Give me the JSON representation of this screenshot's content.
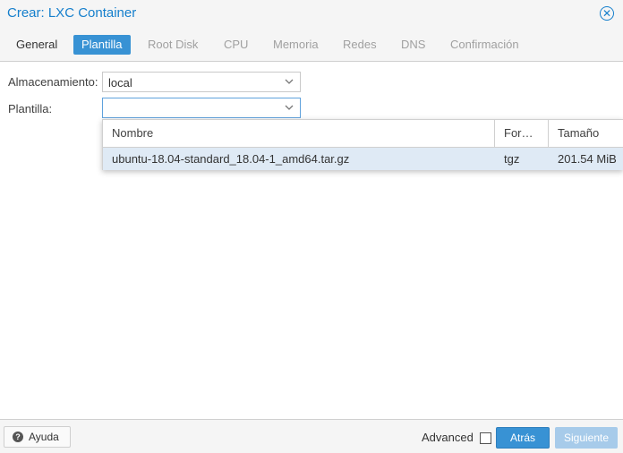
{
  "window": {
    "title": "Crear: LXC Container",
    "close_icon": "close-circle-icon"
  },
  "tabs": [
    {
      "label": "General",
      "state": "enabled"
    },
    {
      "label": "Plantilla",
      "state": "active"
    },
    {
      "label": "Root Disk",
      "state": "disabled"
    },
    {
      "label": "CPU",
      "state": "disabled"
    },
    {
      "label": "Memoria",
      "state": "disabled"
    },
    {
      "label": "Redes",
      "state": "disabled"
    },
    {
      "label": "DNS",
      "state": "disabled"
    },
    {
      "label": "Confirmación",
      "state": "disabled"
    }
  ],
  "form": {
    "storage": {
      "label": "Almacenamiento:",
      "value": "local"
    },
    "template": {
      "label": "Plantilla:",
      "value": ""
    }
  },
  "picker": {
    "columns": [
      "Nombre",
      "For…",
      "Tamaño"
    ],
    "rows": [
      {
        "name": "ubuntu-18.04-standard_18.04-1_amd64.tar.gz",
        "format": "tgz",
        "size": "201.54 MiB"
      }
    ]
  },
  "footer": {
    "help_label": "Ayuda",
    "help_icon": "help-icon",
    "advanced_label": "Advanced",
    "advanced_checked": false,
    "back_label": "Atrás",
    "next_label": "Siguiente"
  },
  "colors": {
    "accent": "#3892d4",
    "title": "#157fcc",
    "selected_row": "#dfeaf5"
  }
}
